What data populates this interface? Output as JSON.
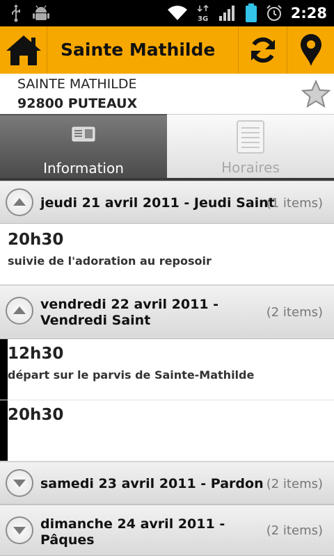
{
  "status_bar": {
    "time": "2:28",
    "network": "3G",
    "icons": [
      "usb-icon",
      "android-debug-icon",
      "wifi-icon",
      "3g-icon",
      "signal-icon",
      "battery-icon",
      "alarm-icon"
    ]
  },
  "action_bar": {
    "title": "Sainte Mathilde",
    "accent_color": "#f7a800",
    "icons": [
      "home-icon",
      "refresh-icon",
      "map-pin-icon"
    ]
  },
  "place": {
    "name": "SAINTE MATHILDE",
    "city": "92800 PUTEAUX",
    "favorite_icon": "star-icon"
  },
  "tabs": [
    {
      "label": "Information",
      "selected": true,
      "icon": "info-card-icon"
    },
    {
      "label": "Horaires",
      "selected": false,
      "icon": "schedule-list-icon"
    }
  ],
  "groups": [
    {
      "title": "jeudi 21 avril 2011 - Jeudi Saint",
      "count": "(1 items)",
      "expanded": true,
      "items": [
        {
          "time": "20h30",
          "description": "suivie de l'adoration au reposoir"
        }
      ]
    },
    {
      "title_line1": "vendredi 22 avril 2011 -",
      "title_line2": "Vendredi Saint",
      "count": "(2 items)",
      "expanded": true,
      "items": [
        {
          "time": "12h30",
          "description": "départ sur le parvis de Sainte-Mathilde"
        },
        {
          "time": "20h30",
          "description": ""
        }
      ]
    },
    {
      "title": "samedi 23 avril 2011 - Pardon",
      "count": "(2 items)",
      "expanded": false
    },
    {
      "title_line1": "dimanche 24 avril 2011 -",
      "title_line2": "Pâques",
      "count": "(2 items)",
      "expanded": false
    }
  ]
}
